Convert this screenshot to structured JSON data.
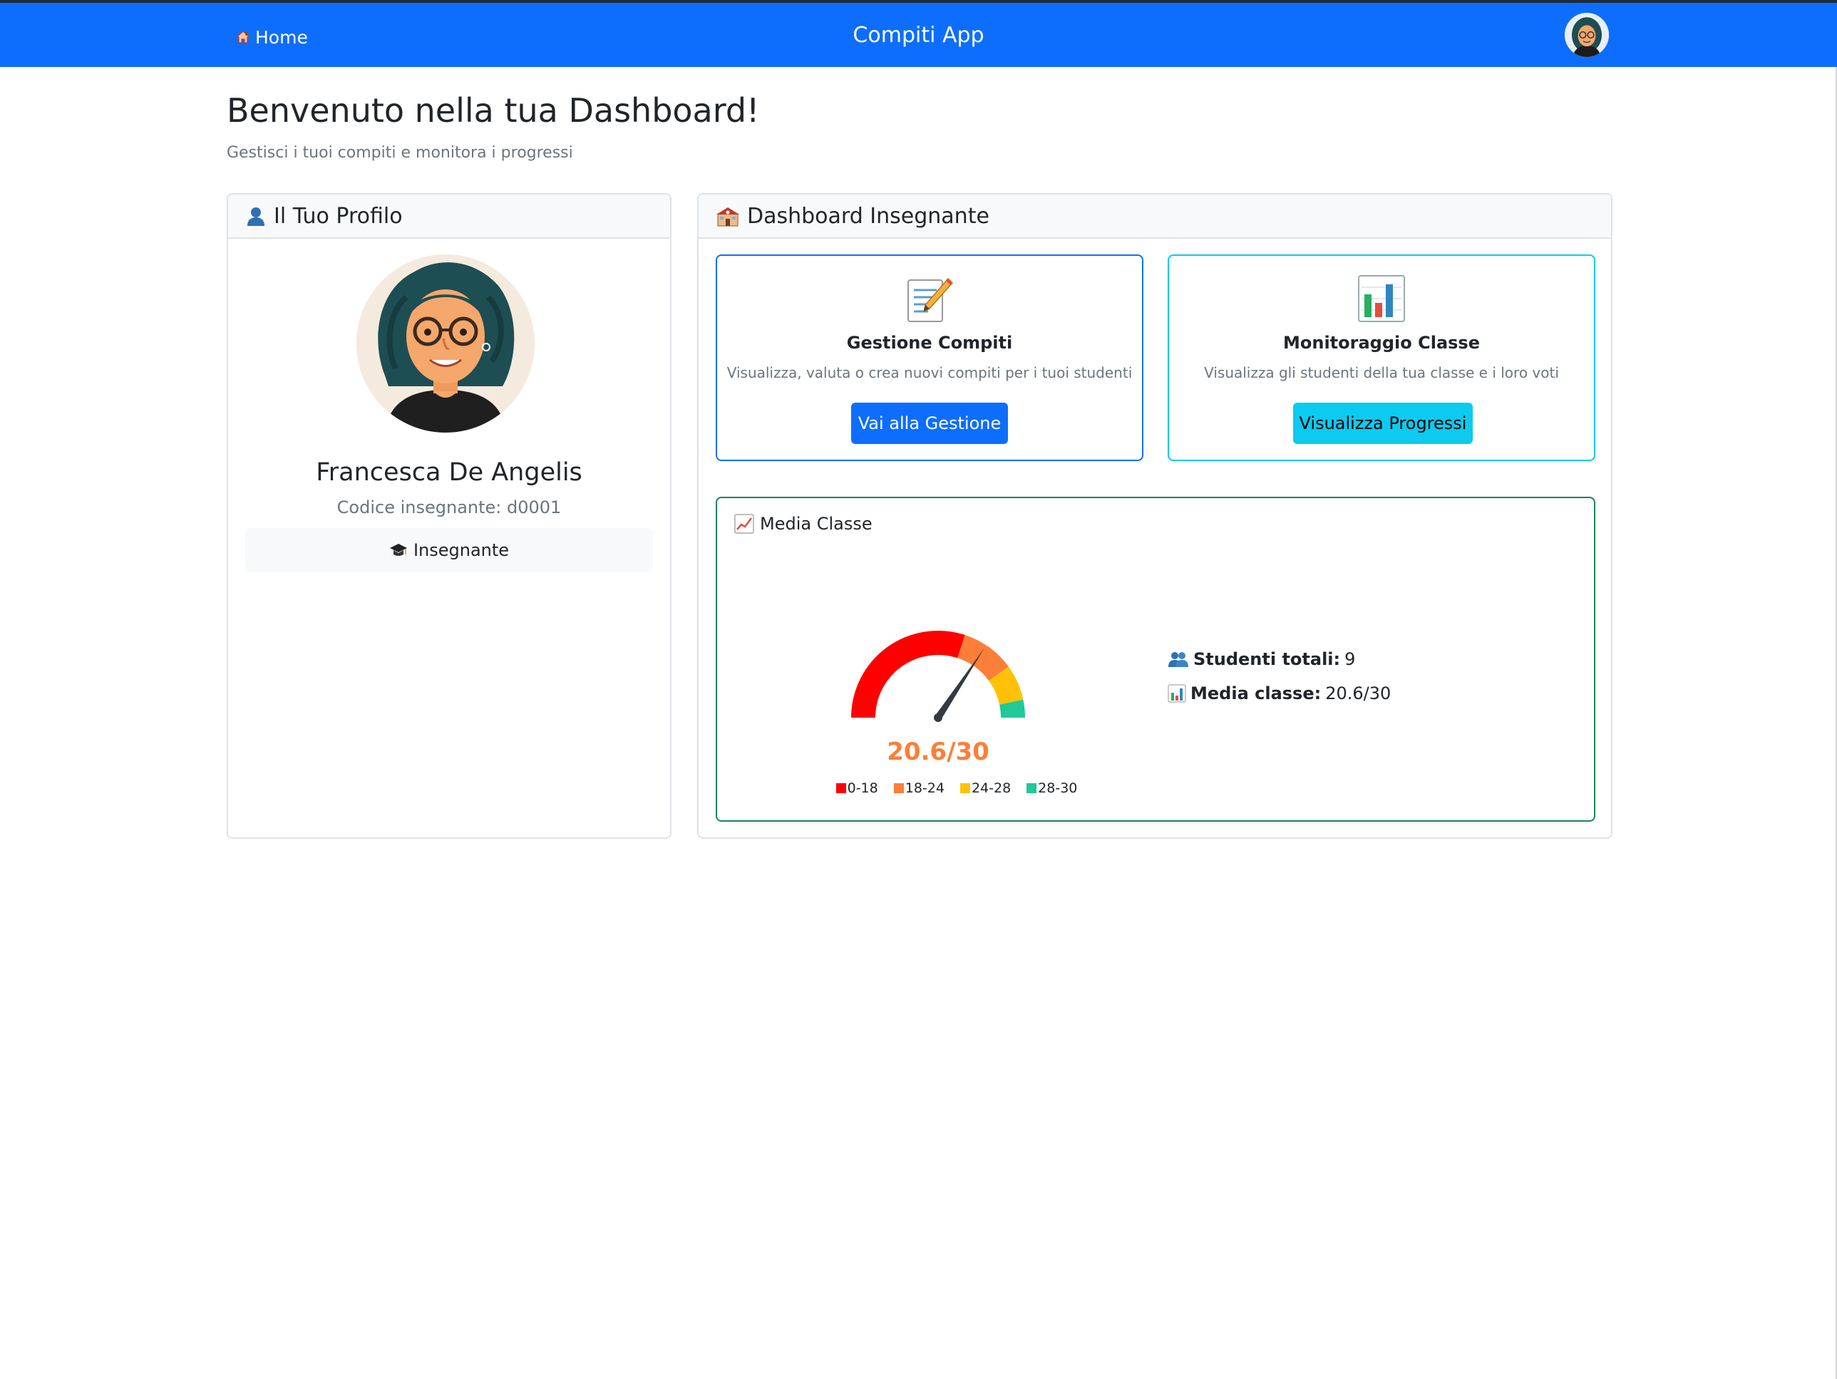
{
  "navbar": {
    "home_label": "Home",
    "title": "Compiti App"
  },
  "header": {
    "title": "Benvenuto nella tua Dashboard!",
    "subtitle": "Gestisci i tuoi compiti e monitora i progressi"
  },
  "profile": {
    "header": "Il Tuo Profilo",
    "name": "Francesca De Angelis",
    "code": "Codice insegnante: d0001",
    "role": "Insegnante"
  },
  "teacher_dashboard": {
    "header": "Dashboard Insegnante",
    "gestione": {
      "title": "Gestione Compiti",
      "description": "Visualizza, valuta o crea nuovi compiti per i tuoi studenti",
      "button": "Vai alla Gestione"
    },
    "monitoraggio": {
      "title": "Monitoraggio Classe",
      "description": "Visualizza gli studenti della tua classe e i loro voti",
      "button": "Visualizza Progressi"
    },
    "media": {
      "title": "Media Classe",
      "gauge_label": "20.6/30",
      "stats": {
        "studenti_label": "Studenti totali:",
        "studenti_value": "9",
        "media_label": "Media classe:",
        "media_value": "20.6/30"
      }
    }
  },
  "chart_data": {
    "type": "gauge",
    "value": 20.6,
    "min": 0,
    "max": 30,
    "bands": [
      {
        "label": "0-18",
        "from": 0,
        "to": 18,
        "color": "#ff0000"
      },
      {
        "label": "18-24",
        "from": 18,
        "to": 24,
        "color": "#fd7e38"
      },
      {
        "label": "24-28",
        "from": 24,
        "to": 28,
        "color": "#ffc107"
      },
      {
        "label": "28-30",
        "from": 28,
        "to": 30,
        "color": "#20c997"
      }
    ],
    "needle_color": "#343a40"
  },
  "colors": {
    "primary": "#0d6efd",
    "info": "#0dcaf0",
    "success": "#198754",
    "accent_value": "#fd7e38"
  },
  "icons": {
    "home": "home-icon",
    "profile": "user-icon",
    "school": "school-icon",
    "memo": "memo-icon",
    "bar_chart": "bar-chart-icon",
    "trend": "chart-increasing-icon",
    "people": "people-icon",
    "graduation": "graduation-cap-icon"
  }
}
